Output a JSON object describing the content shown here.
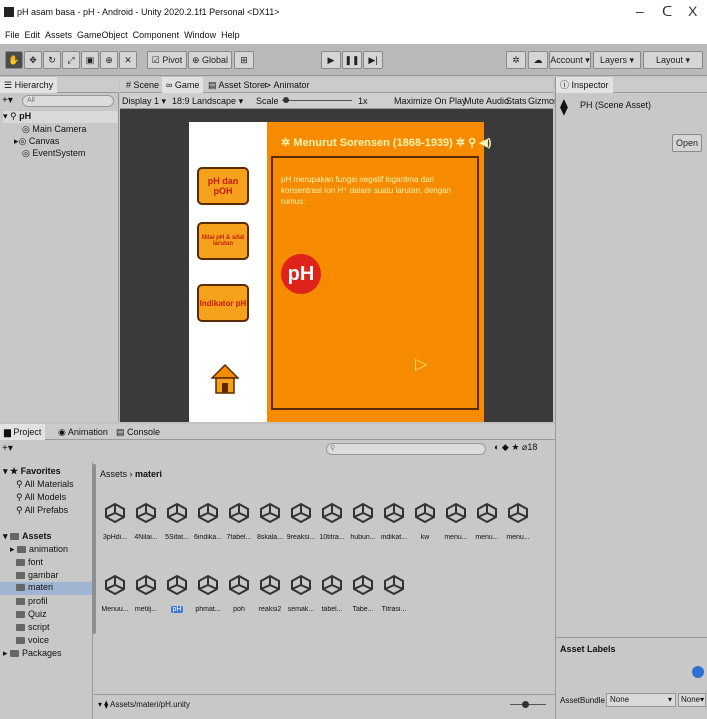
{
  "window": {
    "title": "pH asam basa - pH - Android - Unity 2020.2.1f1 Personal <DX11>",
    "minimize": "–",
    "maximize": "ᑕ",
    "close": "X"
  },
  "menu": [
    "File",
    "Edit",
    "Assets",
    "GameObject",
    "Component",
    "Window",
    "Help"
  ],
  "toolbar": {
    "pivot": "Pivot",
    "global": "Global",
    "account": "Account",
    "layers": "Layers",
    "layout": "Layout"
  },
  "hierarchy": {
    "tab": "Hierarchy",
    "search_placeholder": "All",
    "root": "pH",
    "items": [
      "Main Camera",
      "Canvas",
      "EventSystem"
    ]
  },
  "viewtabs": {
    "scene": "Scene",
    "game": "Game",
    "store": "Asset Store",
    "animator": "Animator"
  },
  "gamebar": {
    "display": "Display 1",
    "aspect": "18:9 Landscape",
    "scale_label": "Scale",
    "scale_value": "1x",
    "maximize": "Maximize On Play",
    "mute": "Mute Audio",
    "stats": "Stats",
    "gizmos": "Gizmos"
  },
  "game": {
    "btn1": "pH dan pOH",
    "btn2": "Nilai pH & sifat larutan",
    "btn3": "Indikator pH",
    "heading": "Menurut Sorensen (1868-1939)",
    "body": "pH merupakan fungsi negatif logaritma dari konsentrasi Ion H⁺ dalam suatu larutan, dengan rumus:",
    "logo": "pH"
  },
  "inspector": {
    "tab": "Inspector",
    "asset": "PH (Scene Asset)",
    "open": "Open",
    "labels": "Asset Labels",
    "bundle_label": "AssetBundle",
    "bundle_value": "None",
    "variant_value": "None"
  },
  "project": {
    "tabs": [
      "Project",
      "Animation",
      "Console"
    ],
    "count": "18",
    "breadcrumb": [
      "Assets",
      "materi"
    ],
    "favorites_label": "Favorites",
    "favorites": [
      "All Materials",
      "All Models",
      "All Prefabs"
    ],
    "assets_label": "Assets",
    "folders": [
      "animation",
      "font",
      "gambar",
      "materi",
      "profil",
      "Quiz",
      "script",
      "voice",
      "Packages"
    ],
    "row1": [
      "3pHdi...",
      "4Nilai...",
      "5Sifat...",
      "6indika...",
      "7tabel...",
      "8skala...",
      "9reaksi...",
      "10titra...",
      "hubun...",
      "indikat...",
      "kw",
      "menu...",
      "menu...",
      "menu..."
    ],
    "row2": [
      "Menuu...",
      "metilj...",
      "pH",
      "phmat...",
      "poh",
      "reaksi2",
      "semak...",
      "tabel...",
      "Tabe...",
      "Titrasi..."
    ],
    "path": "Assets/materi/pH.unity"
  }
}
